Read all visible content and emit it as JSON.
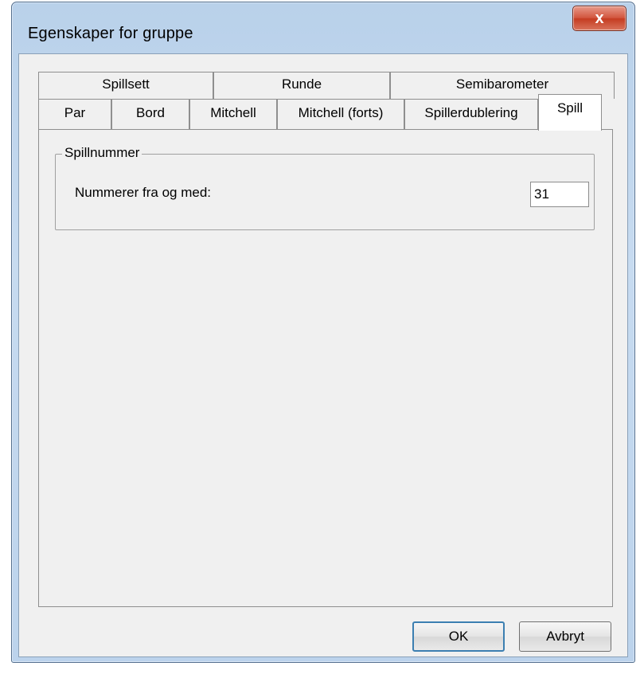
{
  "window": {
    "title": "Egenskaper for gruppe",
    "close_glyph": "x"
  },
  "tabs": {
    "row1": [
      "Spillsett",
      "Runde",
      "Semibarometer"
    ],
    "row2": [
      "Par",
      "Bord",
      "Mitchell",
      "Mitchell (forts)",
      "Spillerdublering",
      "Spill"
    ],
    "active": "Spill"
  },
  "group": {
    "legend": "Spillnummer",
    "field_label": "Nummerer fra og med:",
    "field_value": "31"
  },
  "buttons": {
    "ok": "OK",
    "cancel": "Avbryt"
  },
  "colors": {
    "frame": "#b9d1ea",
    "client": "#f0f0f0",
    "close_button": "#c53c21",
    "default_button_border": "#3c7fb1"
  },
  "icons": {
    "close": "close-icon"
  }
}
